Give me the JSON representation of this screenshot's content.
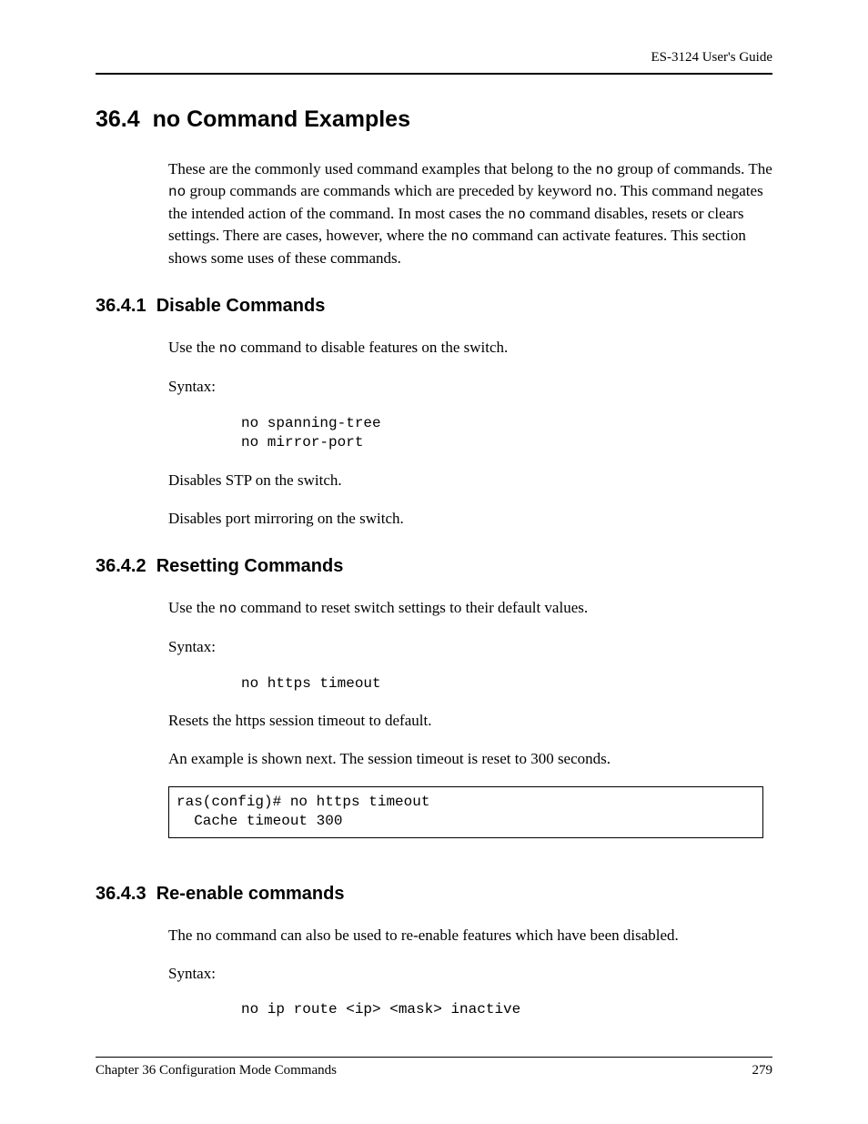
{
  "header": {
    "guideTitle": "ES-3124 User's Guide"
  },
  "section": {
    "number": "36.4",
    "title": "no Command Examples",
    "intro": {
      "part1": "These are the commonly used command examples that belong to the ",
      "mono1": "no",
      "part2": " group of commands. The ",
      "mono2": "no",
      "part3": " group commands are commands which are preceded by keyword ",
      "mono3": "no",
      "part4": ". This command negates the intended action of the command. In most cases the ",
      "mono4": "no",
      "part5": " command disables, resets or clears settings. There are cases, however, where the ",
      "mono5": "no",
      "part6": " command can activate features. This section shows some uses of these commands."
    }
  },
  "sub1": {
    "number": "36.4.1",
    "title": "Disable Commands",
    "intro": {
      "part1": "Use the ",
      "mono1": "no",
      "part2": " command to disable features on the switch."
    },
    "syntaxLabel": "Syntax:",
    "code": "no spanning-tree\nno mirror-port",
    "desc1": "Disables STP on the switch.",
    "desc2": "Disables port mirroring on the switch."
  },
  "sub2": {
    "number": "36.4.2",
    "title": "Resetting Commands",
    "intro": {
      "part1": "Use the ",
      "mono1": "no",
      "part2": " command to reset switch settings to their default values."
    },
    "syntaxLabel": "Syntax:",
    "code": "no https timeout",
    "desc1": "Resets the https session timeout to default.",
    "desc2": "An example is shown next. The session timeout is reset to 300 seconds.",
    "example": "ras(config)# no https timeout\n  Cache timeout 300"
  },
  "sub3": {
    "number": "36.4.3",
    "title": "Re-enable commands",
    "desc1": "The no command can also be used to re-enable features which have been disabled.",
    "syntaxLabel": "Syntax:",
    "code": "no ip route <ip> <mask> inactive"
  },
  "footer": {
    "chapter": "Chapter 36 Configuration Mode Commands",
    "page": "279"
  }
}
